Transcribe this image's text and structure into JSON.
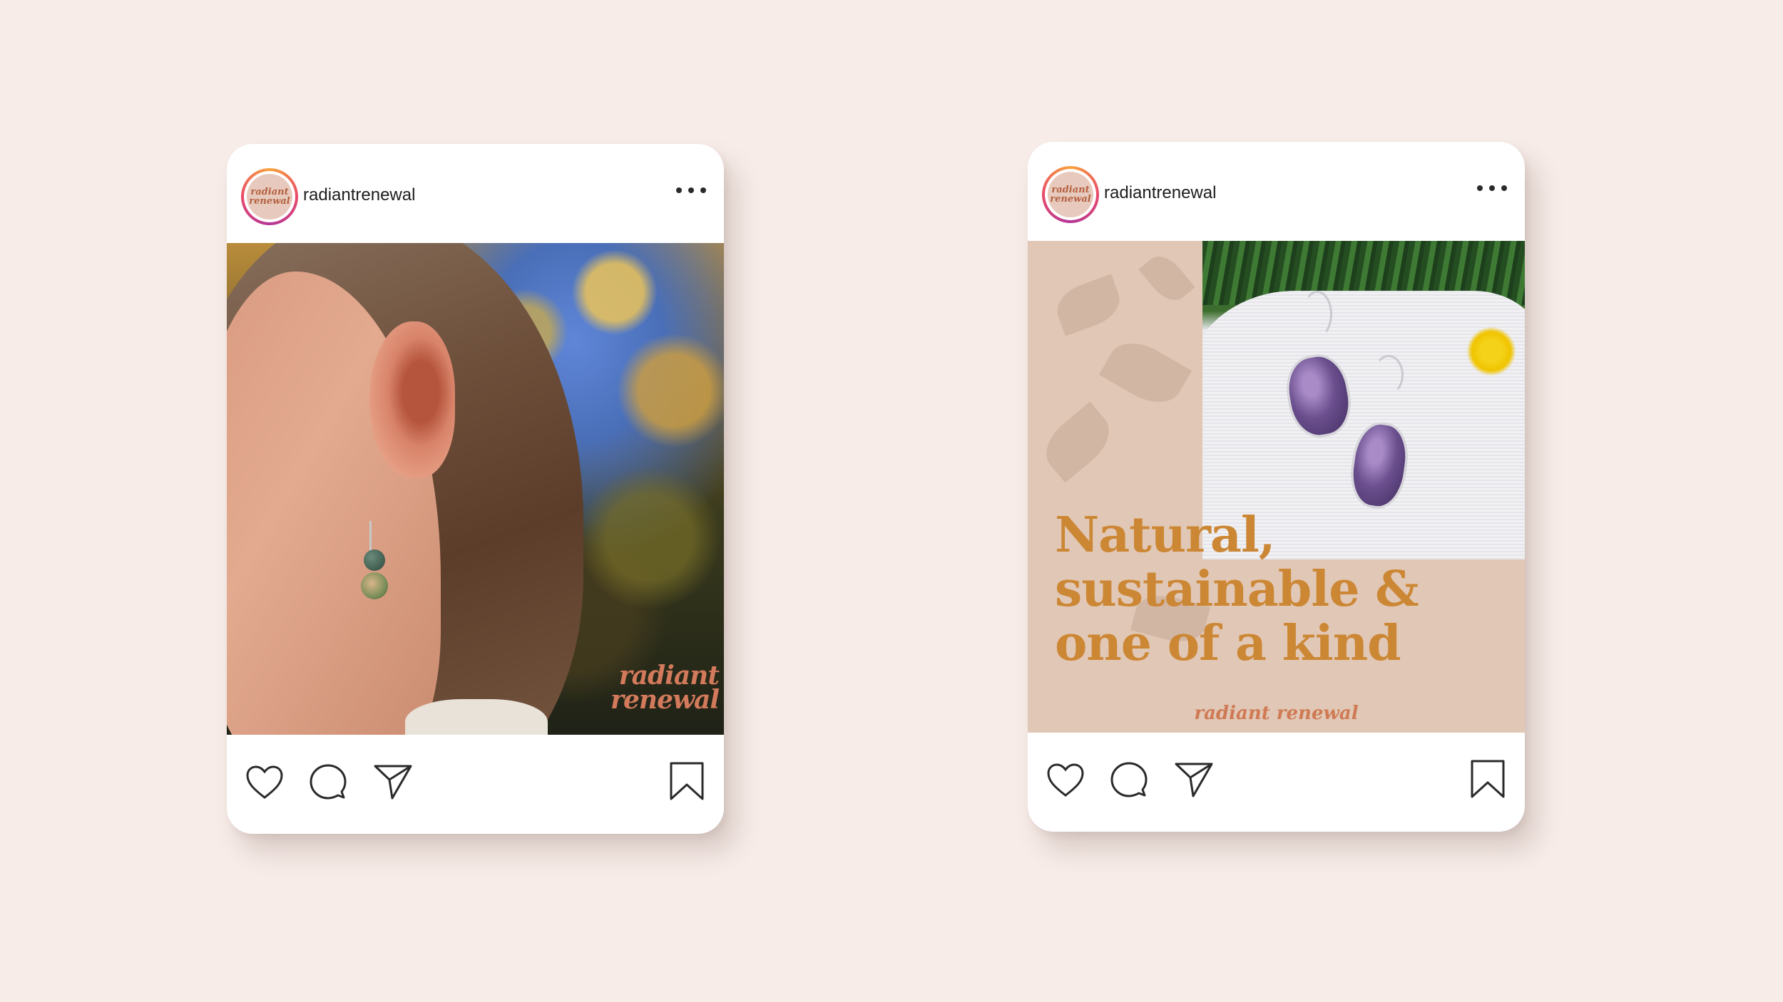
{
  "page": {
    "background": "#f7ece8"
  },
  "posts": [
    {
      "username": "radiantrenewal",
      "avatar": {
        "line1": "radiant",
        "line2": "renewal"
      },
      "image": {
        "watermark_line1": "radiant",
        "watermark_line2": "renewal"
      },
      "actions": [
        "heart-icon",
        "comment-icon",
        "share-icon",
        "bookmark-icon"
      ]
    },
    {
      "username": "radiantrenewal",
      "avatar": {
        "line1": "radiant",
        "line2": "renewal"
      },
      "image": {
        "headline_line1": "Natural,",
        "headline_line2": "sustainable &",
        "headline_line3": "one of a kind",
        "brand": "radiant renewal",
        "text_color": "#cc8734",
        "panel_color": "#e1c7b5"
      },
      "actions": [
        "heart-icon",
        "comment-icon",
        "share-icon",
        "bookmark-icon"
      ]
    }
  ]
}
